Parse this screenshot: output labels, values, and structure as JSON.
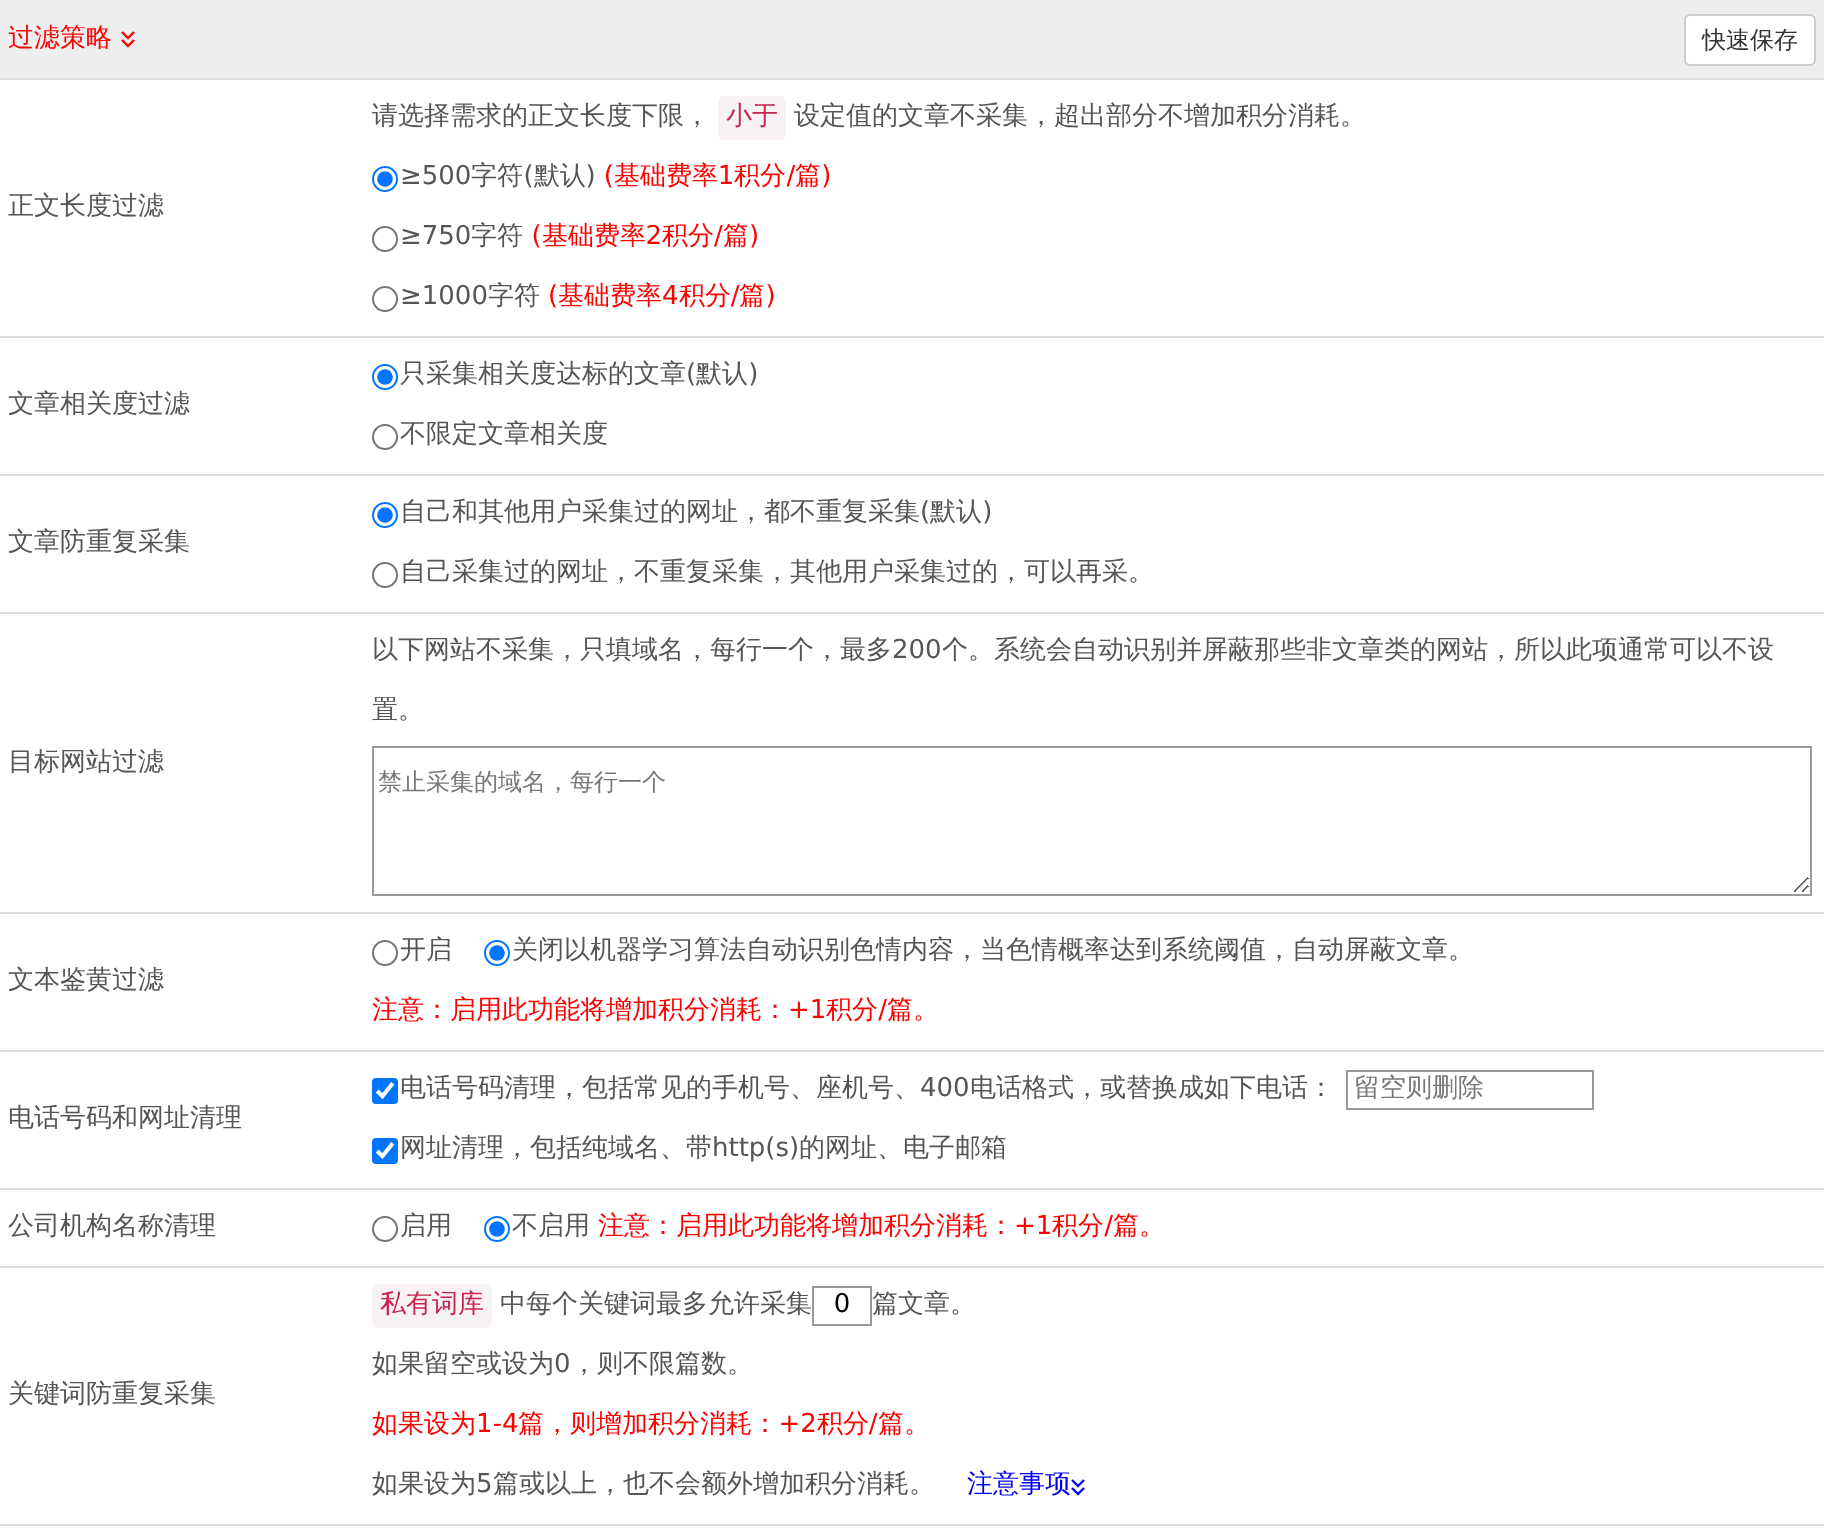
{
  "header": {
    "title": "过滤策略",
    "button": "快速保存"
  },
  "sections": [
    {
      "label": "正文长度过滤",
      "lines": [
        [
          {
            "kind": "text",
            "text": "请选择需求的正文长度下限，"
          },
          {
            "kind": "code",
            "text": "小于"
          },
          {
            "kind": "text",
            "text": "设定值的文章不采集，超出部分不增加积分消耗。"
          }
        ],
        [
          {
            "kind": "radio",
            "label": "≥500字符(默认)",
            "selected": true
          },
          {
            "kind": "note",
            "text": "(基础费率1积分/篇)"
          }
        ],
        [
          {
            "kind": "radio",
            "label": "≥750字符",
            "selected": false
          },
          {
            "kind": "note",
            "text": "(基础费率2积分/篇)"
          }
        ],
        [
          {
            "kind": "radio",
            "label": "≥1000字符",
            "selected": false
          },
          {
            "kind": "note",
            "text": "(基础费率4积分/篇)"
          }
        ]
      ]
    },
    {
      "label": "文章相关度过滤",
      "lines": [
        [
          {
            "kind": "radio",
            "label": "只采集相关度达标的文章(默认)",
            "selected": true
          }
        ],
        [
          {
            "kind": "radio",
            "label": "不限定文章相关度",
            "selected": false
          }
        ]
      ]
    },
    {
      "label": "文章防重复采集",
      "lines": [
        [
          {
            "kind": "radio",
            "label": "自己和其他用户采集过的网址，都不重复采集(默认)",
            "selected": true
          }
        ],
        [
          {
            "kind": "radio",
            "label": "自己采集过的网址，不重复采集，其他用户采集过的，可以再采。",
            "selected": false
          }
        ]
      ]
    },
    {
      "label": "目标网站过滤",
      "lines": [
        [
          {
            "kind": "text",
            "text": "以下网站不采集，只填域名，每行一个，最多200个。系统会自动识别并屏蔽那些非文章类的网站，所以此项通常可以不设置。"
          }
        ],
        [
          {
            "kind": "textarea",
            "placeholder": "禁止采集的域名，每行一个"
          }
        ]
      ]
    },
    {
      "label": "文本鉴黄过滤",
      "lines": [
        [
          {
            "kind": "radio",
            "label": "开启",
            "selected": false
          },
          {
            "kind": "radio",
            "label": "关闭",
            "selected": true
          },
          {
            "kind": "text",
            "text": "以机器学习算法自动识别色情内容，当色情概率达到系统阈值，自动屏蔽文章。"
          }
        ],
        [
          {
            "kind": "note",
            "text": "注意：启用此功能将增加积分消耗：+1积分/篇。"
          }
        ]
      ]
    },
    {
      "label": "电话号码和网址清理",
      "lines": [
        [
          {
            "kind": "checkbox",
            "label": "电话号码清理，包括常见的手机号、座机号、400电话格式，或替换成如下电话：",
            "checked": true
          },
          {
            "kind": "input",
            "placeholder": "留空则删除"
          }
        ],
        [
          {
            "kind": "checkbox",
            "label": "网址清理，包括纯域名、带http(s)的网址、电子邮箱",
            "checked": true
          }
        ]
      ]
    },
    {
      "label": "公司机构名称清理",
      "lines": [
        [
          {
            "kind": "radio",
            "label": "启用",
            "selected": false
          },
          {
            "kind": "radio",
            "label": "不启用",
            "selected": true
          },
          {
            "kind": "note",
            "text": "注意：启用此功能将增加积分消耗：+1积分/篇。"
          }
        ]
      ]
    },
    {
      "label": "关键词防重复采集",
      "lines": [
        [
          {
            "kind": "code",
            "text": "私有词库"
          },
          {
            "kind": "text",
            "text": "中每个关键词最多允许采集"
          },
          {
            "kind": "number",
            "value": "0"
          },
          {
            "kind": "text",
            "text": "篇文章。"
          }
        ],
        [
          {
            "kind": "text",
            "text": "如果留空或设为0，则不限篇数。"
          }
        ],
        [
          {
            "kind": "note",
            "text": "如果设为1-4篇，则增加积分消耗：+2积分/篇。"
          }
        ],
        [
          {
            "kind": "text",
            "text": "如果设为5篇或以上，也不会额外增加积分消耗。"
          },
          {
            "kind": "link",
            "text": "注意事项"
          }
        ]
      ]
    }
  ]
}
